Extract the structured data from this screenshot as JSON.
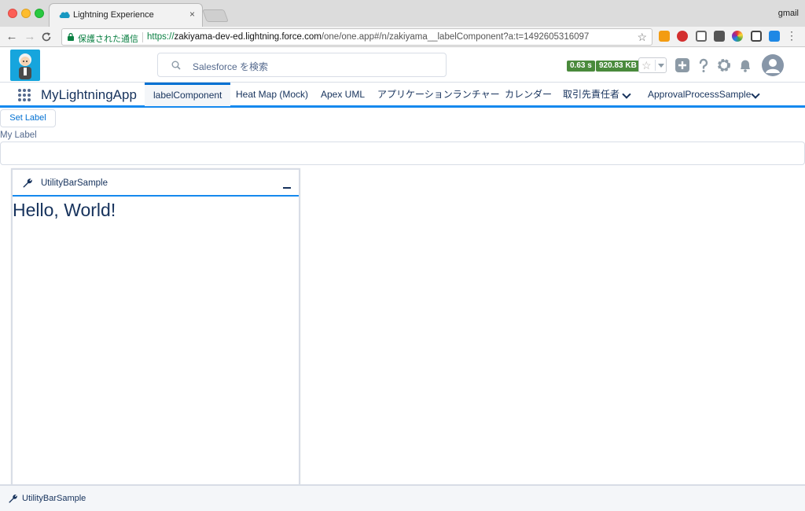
{
  "browser": {
    "tab_title": "Lightning Experience",
    "tab_close": "×",
    "profile": "gmail",
    "secure_label": "保護された通信",
    "url_scheme": "https://",
    "url_host": "zakiyama-dev-ed.lightning.force.com",
    "url_path": "/one/one.app#/n/zakiyama__labelComponent?a:t=1492605316097",
    "back": "←",
    "forward": "→",
    "reload": "C",
    "bookmark": "☆",
    "menu": "⋮"
  },
  "header": {
    "search_placeholder": "Salesforce を検索",
    "perf_time": "0.63 s",
    "perf_size": "920.83 KB",
    "favorite_star": "☆"
  },
  "app_nav": {
    "app_name": "MyLightningApp",
    "items": [
      {
        "label": "labelComponent"
      },
      {
        "label": "Heat Map (Mock)"
      },
      {
        "label": "Apex UML"
      },
      {
        "label": "アプリケーションランチャー"
      },
      {
        "label": "カレンダー"
      },
      {
        "label": "取引先責任者"
      },
      {
        "label": "ApprovalProcessSample"
      }
    ]
  },
  "content": {
    "set_label_button": "Set Label",
    "field_label": "My Label",
    "field_value": ""
  },
  "utility_panel": {
    "title": "UtilityBarSample",
    "body_text": "Hello, World!"
  },
  "utility_bar": {
    "item_label": "UtilityBarSample"
  },
  "colors": {
    "brand": "#1589ee",
    "accent": "#0070d2",
    "text": "#16325c",
    "perf_badge": "#4a8a3c"
  }
}
